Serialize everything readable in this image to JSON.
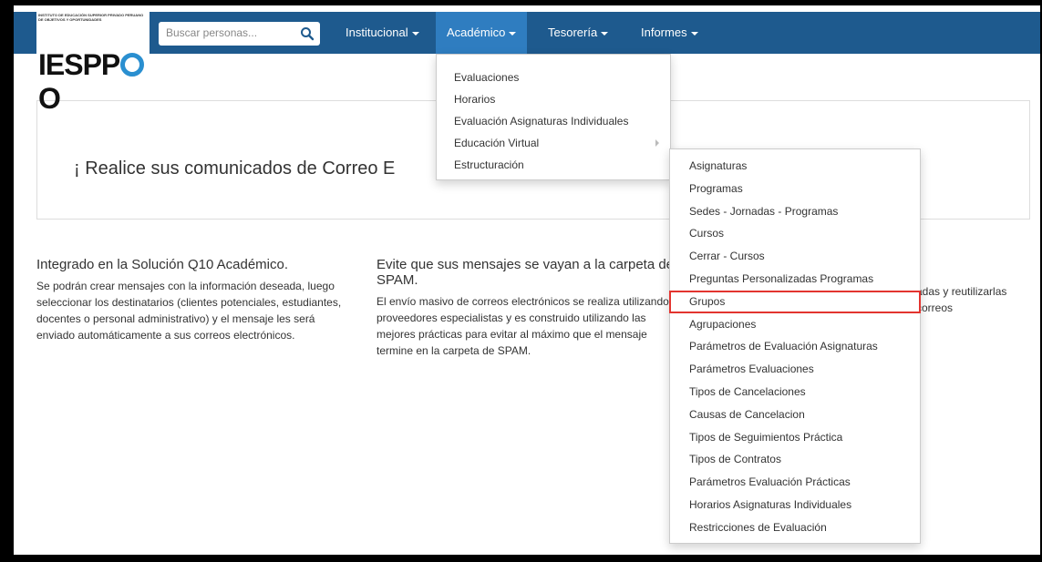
{
  "logo": {
    "small_text": "INSTITUTO DE EDUCACIÓN SUPERIOR PRIVADO PERUANO DE OBJETIVOS Y OPORTUNIDADES",
    "text_left": "IESPP",
    "text_right": "O"
  },
  "search": {
    "placeholder": "Buscar personas..."
  },
  "nav": {
    "institucional": "Institucional",
    "academico": "Académico",
    "tesoreria": "Tesorería",
    "informes": "Informes"
  },
  "dropdown": {
    "items": [
      "Evaluaciones",
      "Horarios",
      "Evaluación Asignaturas Individuales",
      "Educación Virtual",
      "Estructuración"
    ]
  },
  "submenu": {
    "items": [
      "Asignaturas",
      "Programas",
      "Sedes - Jornadas - Programas",
      "Cursos",
      "Cerrar - Cursos",
      "Preguntas Personalizadas Programas",
      "Grupos",
      "Agrupaciones",
      "Parámetros de Evaluación Asignaturas",
      "Parámetros Evaluaciones",
      "Tipos de Cancelaciones",
      "Causas de Cancelacion",
      "Tipos de Seguimientos Práctica",
      "Tipos de Contratos",
      "Parámetros Evaluación Prácticas",
      "Horarios Asignaturas Individuales",
      "Restricciones de Evaluación"
    ]
  },
  "panel": {
    "text": "¡ Realice sus comunicados de Correo E"
  },
  "features": {
    "col1": {
      "title": "Integrado en la Solución Q10 Académico.",
      "body": "Se podrán crear mensajes con la información deseada, luego seleccionar los destinatarios (clientes potenciales, estudiantes, docentes o personal administrativo) y el mensaje les será enviado automáticamente a sus correos electrónicos."
    },
    "col2": {
      "title": "Evite que sus mensajes se vayan a la carpeta de SPAM.",
      "body": "El envío masivo de correos electrónicos se realiza utilizando proveedores especialistas y es construido utilizando las mejores prácticas para evitar al máximo que el mensaje termine en la carpeta de SPAM."
    },
    "col3": {
      "body": "adas y reutilizarlas correos"
    }
  },
  "colors": {
    "navbar": "#1e5a8e",
    "nav_active": "#2f7dc0",
    "highlight_border": "#e3342f"
  }
}
